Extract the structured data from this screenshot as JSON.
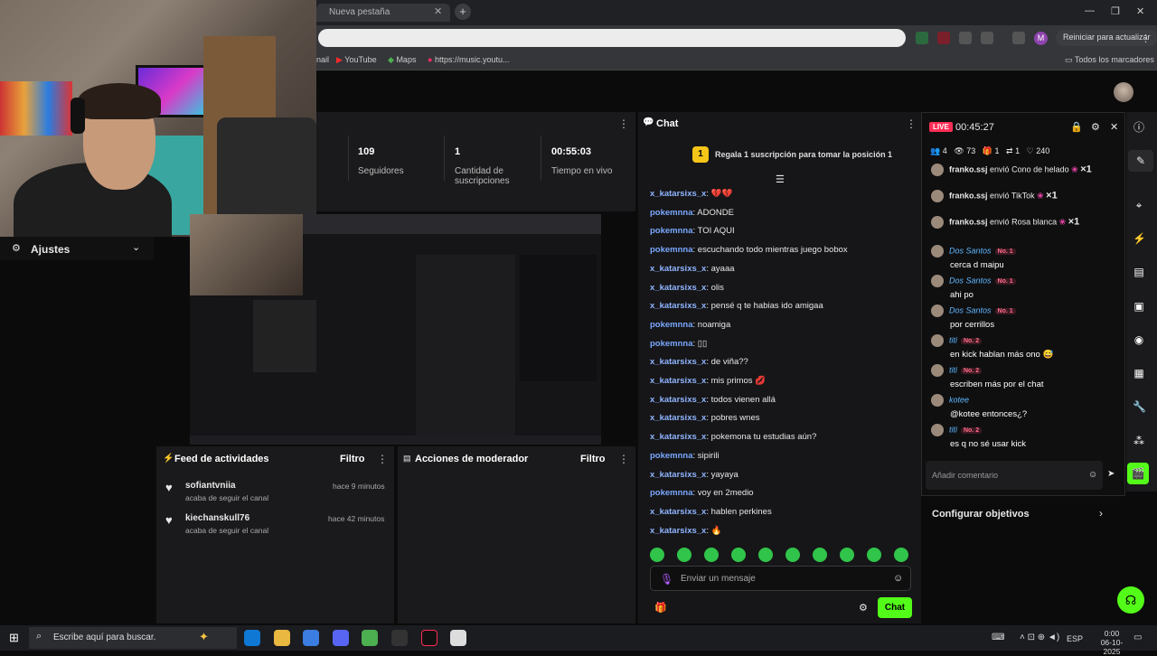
{
  "browser": {
    "tab_title": "Nueva pestaña",
    "reiniciar_label": "Reiniciar para actualizar",
    "profile_letter": "M",
    "bookmarks": [
      "nail",
      "YouTube",
      "Maps",
      "https://music.youtu..."
    ],
    "all_bookmarks": "Todos los marcadores"
  },
  "settings": {
    "label": "Ajustes"
  },
  "stats": [
    {
      "value": "109",
      "label": "Seguidores"
    },
    {
      "value": "1",
      "label": "Cantidad de suscripciones"
    },
    {
      "value": "00:55:03",
      "label": "Tiempo en vivo"
    }
  ],
  "feed": {
    "title": "Feed de actividades",
    "filter": "Filtro",
    "items": [
      {
        "user": "sofiantvniia",
        "time": "hace 9 minutos",
        "desc": "acaba de seguir el canal"
      },
      {
        "user": "kiechanskull76",
        "time": "hace 42 minutos",
        "desc": "acaba de seguir el canal"
      }
    ]
  },
  "moderator": {
    "title": "Acciones de moderador",
    "filter": "Filtro"
  },
  "chat": {
    "title": "Chat",
    "pinned_rank": "1",
    "pinned_text": "Regala 1 suscripción para tomar la posición 1",
    "messages": [
      {
        "user": "x_katarsixs_x",
        "text": "💔💔",
        "c": "u1"
      },
      {
        "user": "pokemnna",
        "text": "ADONDE",
        "c": "u2"
      },
      {
        "user": "pokemnna",
        "text": "TOI AQUI",
        "c": "u2"
      },
      {
        "user": "pokemnna",
        "text": "escuchando todo mientras juego bobox",
        "c": "u2"
      },
      {
        "user": "x_katarsixs_x",
        "text": "ayaaa",
        "c": "u1"
      },
      {
        "user": "x_katarsixs_x",
        "text": "olis",
        "c": "u1"
      },
      {
        "user": "x_katarsixs_x",
        "text": "pensé q te habias ido amigaa",
        "c": "u1"
      },
      {
        "user": "pokemnna",
        "text": "noamiga",
        "c": "u2"
      },
      {
        "user": "pokemnna",
        "text": "▯▯",
        "c": "u2"
      },
      {
        "user": "x_katarsixs_x",
        "text": "de viña??",
        "c": "u1"
      },
      {
        "user": "x_katarsixs_x",
        "text": "mis primos 💋",
        "c": "u1"
      },
      {
        "user": "x_katarsixs_x",
        "text": "todos vienen allá",
        "c": "u1"
      },
      {
        "user": "x_katarsixs_x",
        "text": "pobres wnes",
        "c": "u1"
      },
      {
        "user": "x_katarsixs_x",
        "text": "pokemona tu estudias aún?",
        "c": "u1"
      },
      {
        "user": "pokemnna",
        "text": "sipirili",
        "c": "u2"
      },
      {
        "user": "x_katarsixs_x",
        "text": "yayaya",
        "c": "u1"
      },
      {
        "user": "pokemnna",
        "text": "voy en 2medio",
        "c": "u2"
      },
      {
        "user": "x_katarsixs_x",
        "text": "hablen perkines",
        "c": "u1"
      },
      {
        "user": "x_katarsixs_x",
        "text": "🔥",
        "c": "u1"
      }
    ],
    "input_placeholder": "Enviar un mensaje",
    "send_label": "Chat"
  },
  "live": {
    "badge": "LIVE",
    "timer": "00:45:27",
    "counts": [
      "4",
      "73",
      "1",
      "1",
      "240"
    ],
    "gifts": [
      {
        "user": "franko.ssj",
        "text": "envió Cono de helado",
        "mult": "×1"
      },
      {
        "user": "franko.ssj",
        "text": "envió TikTok",
        "mult": "×1"
      },
      {
        "user": "franko.ssj",
        "text": "envió Rosa blanca",
        "mult": "×1"
      }
    ],
    "comments": [
      {
        "user": "Dos Santos",
        "rank": "No. 1",
        "text": "cerca d maipu"
      },
      {
        "user": "Dos Santos",
        "rank": "No. 1",
        "text": "ahi po"
      },
      {
        "user": "Dos Santos",
        "rank": "No. 1",
        "text": "por cerrillos"
      },
      {
        "user": "titi",
        "rank": "No. 2",
        "text": "en kick hablan más ono 😅"
      },
      {
        "user": "titi",
        "rank": "No. 2",
        "text": "escriben más por el chat"
      },
      {
        "user": "kotee",
        "rank": "",
        "text": "@kotee entonces¿?"
      },
      {
        "user": "titi",
        "rank": "No. 2",
        "text": "es q no sé usar kick"
      }
    ],
    "comment_placeholder": "Añadir comentario"
  },
  "configurar": "Configurar objetivos",
  "taskbar": {
    "search_placeholder": "Escribe aquí para buscar.",
    "lang": "ESP",
    "time": "0:00",
    "date": "06-10-2025"
  }
}
